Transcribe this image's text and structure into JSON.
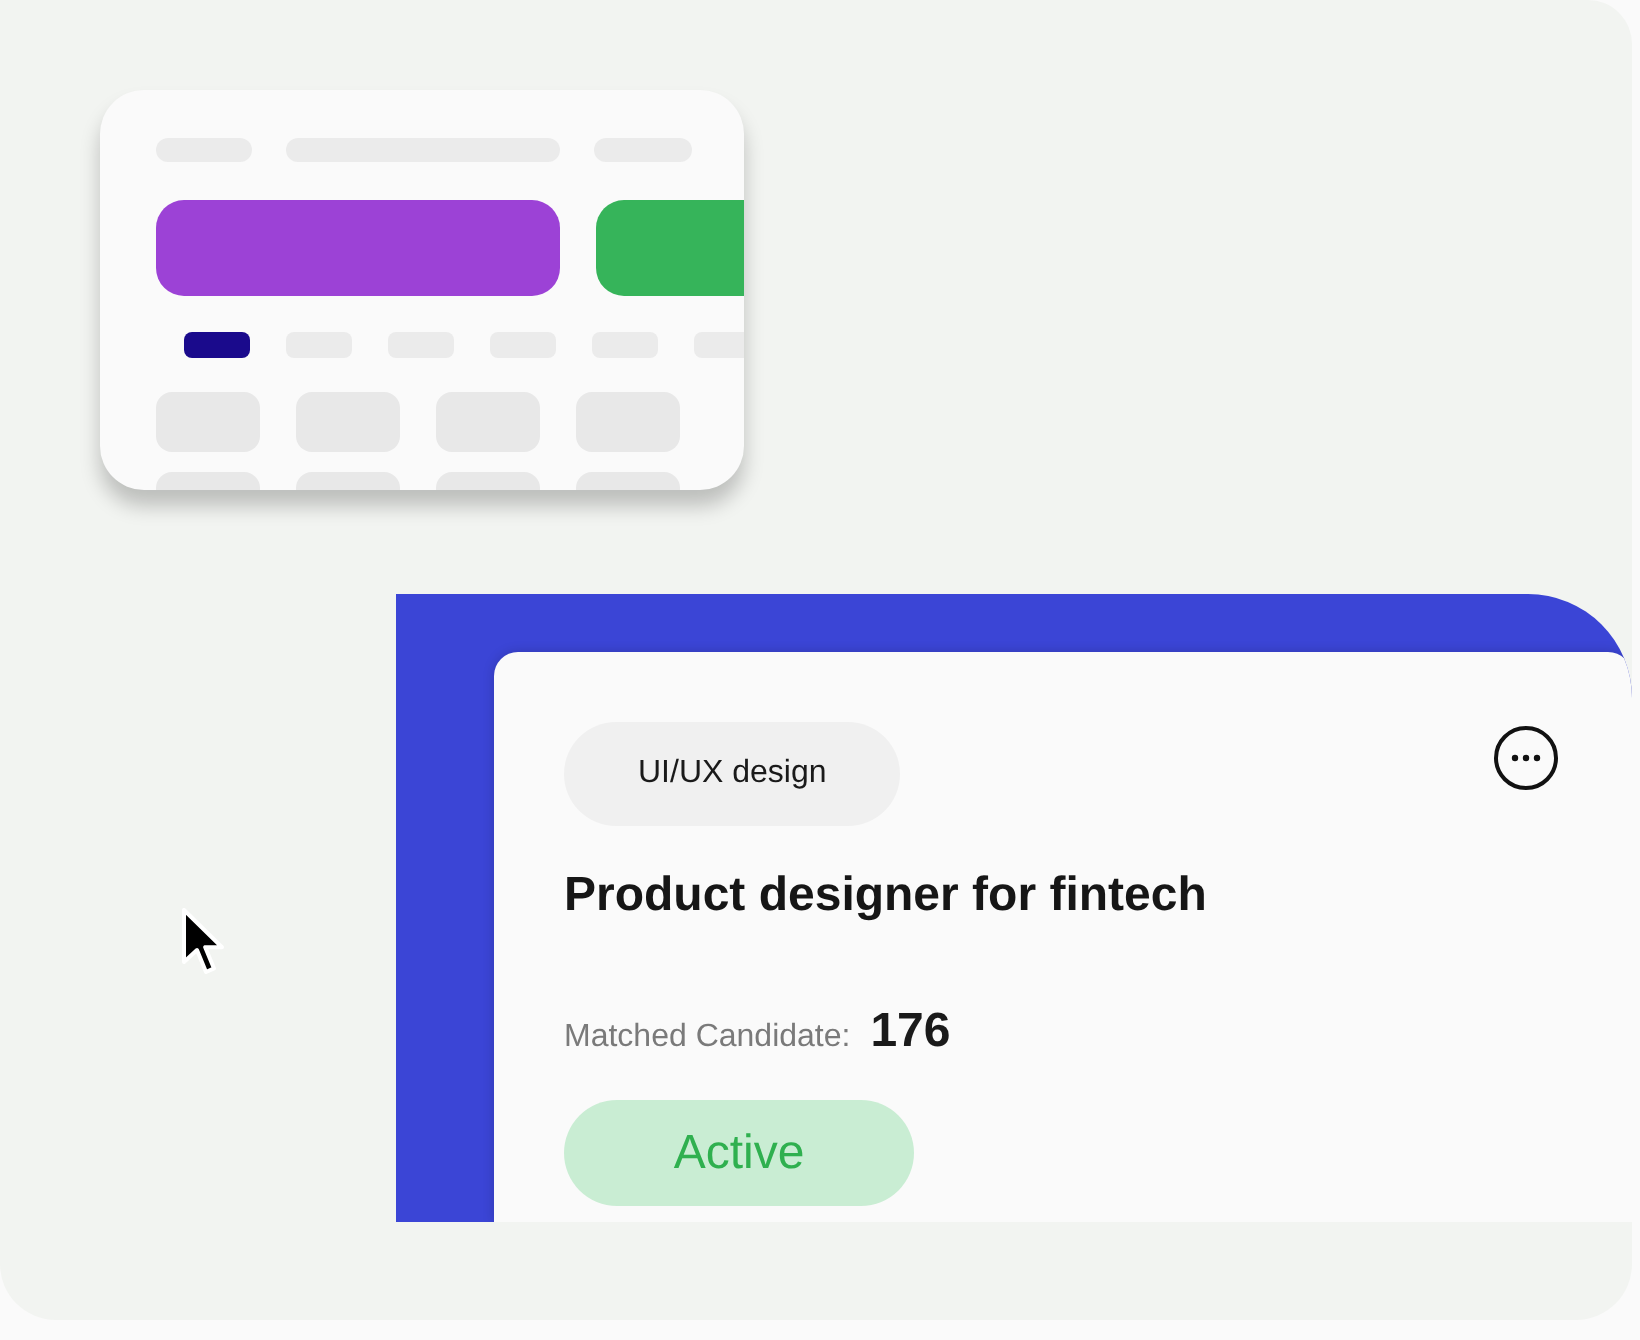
{
  "job_card": {
    "tag": "UI/UX design",
    "title": "Product designer for fintech",
    "matched_label": "Matched Candidate:",
    "matched_count": "176",
    "status": "Active"
  }
}
